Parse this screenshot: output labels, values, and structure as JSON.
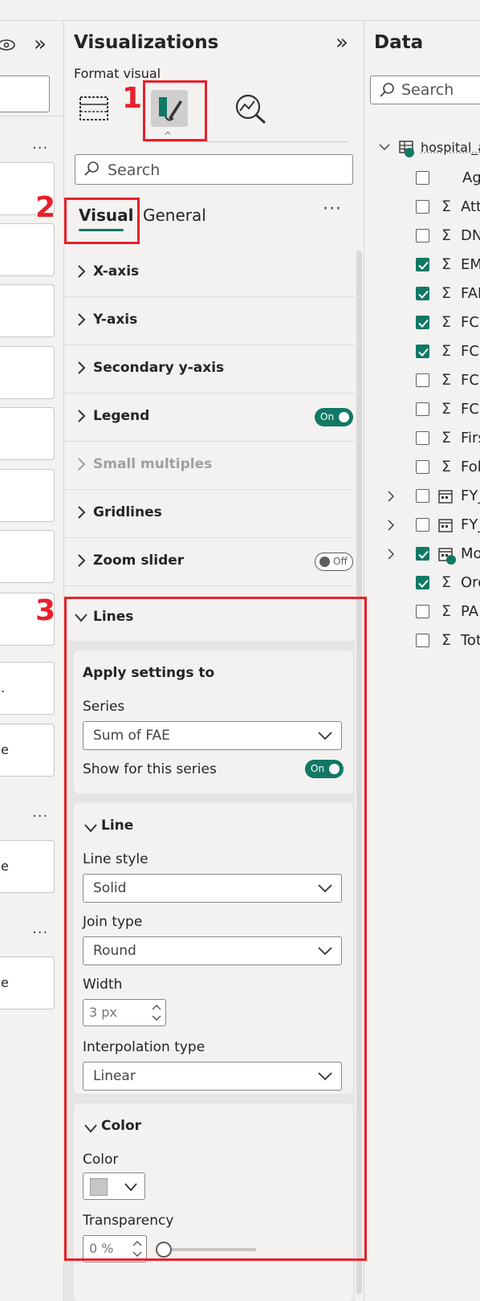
{
  "filters_pane": {
    "cards": [
      "",
      "",
      "",
      "",
      "",
      "",
      "",
      "",
      ".",
      "e",
      "e",
      "e"
    ]
  },
  "visualizations": {
    "title": "Visualizations",
    "format_label": "Format visual",
    "search_placeholder": "Search",
    "tabs": {
      "visual": "Visual",
      "general": "General",
      "more": "···"
    },
    "sections": [
      {
        "label": "X-axis"
      },
      {
        "label": "Y-axis"
      },
      {
        "label": "Secondary y-axis"
      },
      {
        "label": "Legend",
        "toggle": "On"
      },
      {
        "label": "Small multiples",
        "disabled": true
      },
      {
        "label": "Gridlines"
      },
      {
        "label": "Zoom slider",
        "toggle": "Off"
      }
    ],
    "lines": {
      "label": "Lines",
      "apply_settings": {
        "title": "Apply settings to",
        "series_label": "Series",
        "series_value": "Sum of FAE",
        "show_label": "Show for this series",
        "show_toggle": "On"
      },
      "line": {
        "title": "Line",
        "style_label": "Line style",
        "style_value": "Solid",
        "join_label": "Join type",
        "join_value": "Round",
        "width_label": "Width",
        "width_value": "3 px",
        "interp_label": "Interpolation type",
        "interp_value": "Linear"
      },
      "color": {
        "title": "Color",
        "color_label": "Color",
        "swatch": "#c8c6c4",
        "transparency_label": "Transparency",
        "transparency_value": "0 %",
        "transparency_level": 0
      }
    }
  },
  "data_pane": {
    "title": "Data",
    "search_placeholder": "Search",
    "table_name": "hospital_a",
    "fields": [
      {
        "name": "Ag",
        "checked": false,
        "icon": "none"
      },
      {
        "name": "Att",
        "checked": false,
        "icon": "sigma"
      },
      {
        "name": "DN",
        "checked": false,
        "icon": "sigma"
      },
      {
        "name": "EM",
        "checked": true,
        "icon": "sigma"
      },
      {
        "name": "FAI",
        "checked": true,
        "icon": "sigma"
      },
      {
        "name": "FCI",
        "checked": true,
        "icon": "sigma"
      },
      {
        "name": "FCI",
        "checked": true,
        "icon": "sigma"
      },
      {
        "name": "FCI",
        "checked": false,
        "icon": "sigma"
      },
      {
        "name": "FCI",
        "checked": false,
        "icon": "sigma"
      },
      {
        "name": "Firs",
        "checked": false,
        "icon": "sigma"
      },
      {
        "name": "Fol",
        "checked": false,
        "icon": "sigma"
      },
      {
        "name": "FY_",
        "checked": false,
        "icon": "calendar",
        "expandable": true
      },
      {
        "name": "FY_",
        "checked": false,
        "icon": "calendar",
        "expandable": true
      },
      {
        "name": "Mo",
        "checked": true,
        "icon": "calendar",
        "expandable": true
      },
      {
        "name": "Ord",
        "checked": true,
        "icon": "sigma"
      },
      {
        "name": "PA",
        "checked": false,
        "icon": "sigma"
      },
      {
        "name": "Tot",
        "checked": false,
        "icon": "sigma"
      }
    ]
  },
  "annotations": [
    "1",
    "2",
    "3"
  ],
  "colors": {
    "accent": "#117865",
    "annotation": "#e8202a"
  }
}
